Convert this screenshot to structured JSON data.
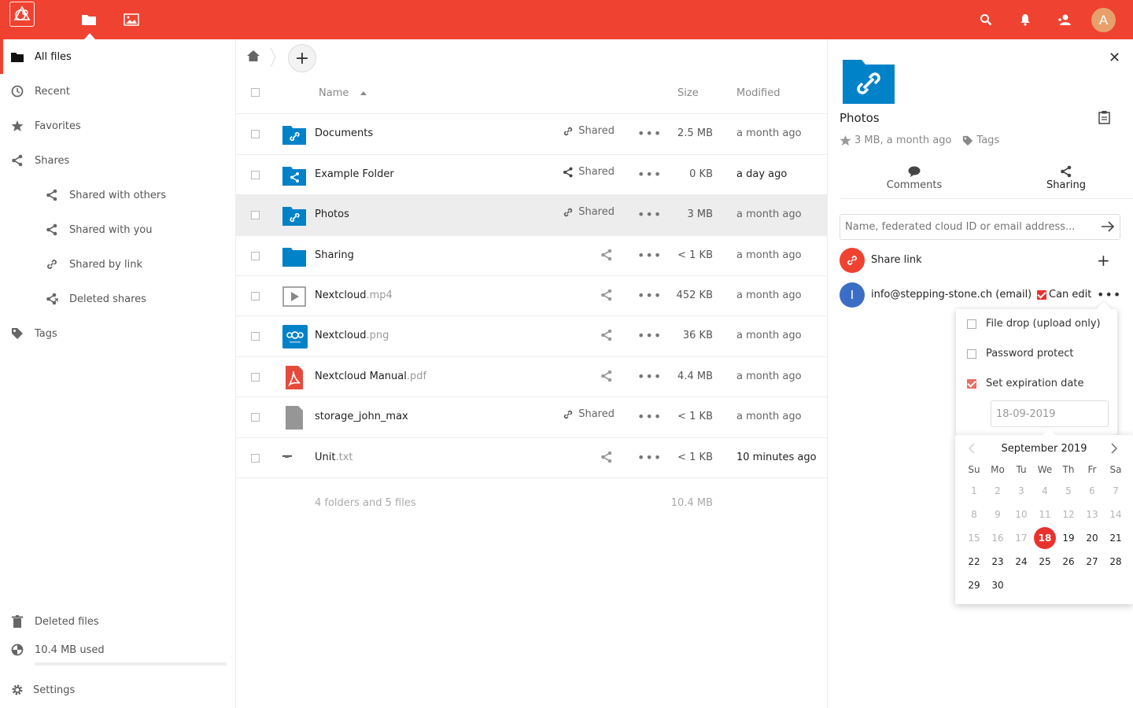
{
  "header": {
    "avatar_letter": "A",
    "accent": "#f04231"
  },
  "sidebar": {
    "items": [
      {
        "label": "All files"
      },
      {
        "label": "Recent"
      },
      {
        "label": "Favorites"
      },
      {
        "label": "Shares"
      },
      {
        "label": "Shared with others"
      },
      {
        "label": "Shared with you"
      },
      {
        "label": "Shared by link"
      },
      {
        "label": "Deleted shares"
      },
      {
        "label": "Tags"
      }
    ],
    "footer": {
      "deleted_label": "Deleted files",
      "quota_label": "10.4 MB used",
      "settings_label": "Settings"
    }
  },
  "filelist": {
    "new_label": "+",
    "columns": {
      "name": "Name",
      "size": "Size",
      "modified": "Modified"
    },
    "rows": [
      {
        "name": "Documents",
        "ext": "",
        "shared_label": "Shared",
        "size": "2.5 MB",
        "modified": "a month ago"
      },
      {
        "name": "Example Folder",
        "ext": "",
        "shared_label": "Shared",
        "size": "0 KB",
        "modified": "a day ago"
      },
      {
        "name": "Photos",
        "ext": "",
        "shared_label": "Shared",
        "size": "3 MB",
        "modified": "a month ago"
      },
      {
        "name": "Sharing",
        "ext": "",
        "shared_label": "",
        "size": "< 1 KB",
        "modified": "a month ago"
      },
      {
        "name": "Nextcloud",
        "ext": ".mp4",
        "shared_label": "",
        "size": "452 KB",
        "modified": "a month ago"
      },
      {
        "name": "Nextcloud",
        "ext": ".png",
        "shared_label": "",
        "size": "36 KB",
        "modified": "a month ago"
      },
      {
        "name": "Nextcloud Manual",
        "ext": ".pdf",
        "shared_label": "",
        "size": "4.4 MB",
        "modified": "a month ago"
      },
      {
        "name": "storage_john_max",
        "ext": "",
        "shared_label": "Shared",
        "size": "< 1 KB",
        "modified": "a month ago"
      },
      {
        "name": "Unit",
        "ext": ".txt",
        "shared_label": "",
        "size": "< 1 KB",
        "modified": "10 minutes ago"
      }
    ],
    "summary": {
      "count": "4 folders and 5 files",
      "total": "10.4 MB"
    }
  },
  "details": {
    "title": "Photos",
    "meta": "3 MB, a month ago",
    "tags_label": "Tags",
    "tabs": {
      "comments": "Comments",
      "sharing": "Sharing"
    },
    "share_placeholder": "Name, federated cloud ID or email address...",
    "share_link_label": "Share link",
    "email_share": {
      "avatar_letter": "I",
      "label": "info@stepping-stone.ch (email)",
      "can_edit_label": "Can edit"
    },
    "menu": {
      "file_drop": "File drop (upload only)",
      "password": "Password protect",
      "expiration": "Set expiration date",
      "date_value": "18-09-2019"
    },
    "calendar": {
      "title": "September 2019",
      "weekdays": [
        "Su",
        "Mo",
        "Tu",
        "We",
        "Th",
        "Fr",
        "Sa"
      ],
      "days": [
        "1",
        "2",
        "3",
        "4",
        "5",
        "6",
        "7",
        "8",
        "9",
        "10",
        "11",
        "12",
        "13",
        "14",
        "15",
        "16",
        "17",
        "18",
        "19",
        "20",
        "21",
        "22",
        "23",
        "24",
        "25",
        "26",
        "27",
        "28",
        "29",
        "30"
      ],
      "selected_day": "18"
    }
  }
}
